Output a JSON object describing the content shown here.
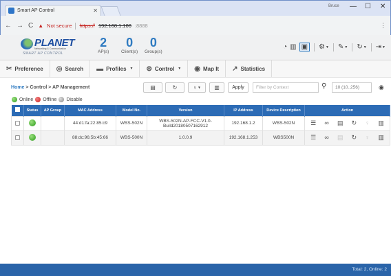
{
  "browser": {
    "tab_title": "Smart AP Control",
    "user_label": "Bruce",
    "not_secure": "Not secure",
    "url_scheme": "https://",
    "url_host": "192.168.1.100",
    "url_port": ":8888",
    "min_glyph": "—",
    "max_glyph": "☐",
    "close_glyph": "✕"
  },
  "header": {
    "logo_brand": "PLANET",
    "logo_tagline": "Networking & Communication",
    "logo_sub": "SMART AP CONTROL",
    "counters": [
      {
        "num": "2",
        "label": "AP(s)"
      },
      {
        "num": "0",
        "label": "Client(s)"
      },
      {
        "num": "0",
        "label": "Group(s)"
      }
    ]
  },
  "menu": {
    "items": [
      {
        "label": "Preference",
        "icon": "wrench-icon"
      },
      {
        "label": "Search",
        "icon": "search-icon"
      },
      {
        "label": "Profiles",
        "icon": "folder-icon",
        "dropdown": true
      },
      {
        "label": "Control",
        "icon": "router-icon",
        "dropdown": true
      },
      {
        "label": "Map It",
        "icon": "map-pin-icon"
      },
      {
        "label": "Statistics",
        "icon": "chart-line-icon"
      }
    ]
  },
  "breadcrumb": {
    "home": "Home",
    "rest": " > Control > AP Management"
  },
  "toolbar": {
    "apply_label": "Apply",
    "filter_placeholder": "Filter by Context",
    "paging_placeholder": "10 (10..256)"
  },
  "legend": {
    "online": "Online",
    "offline": "Offline",
    "disable": "Disable"
  },
  "table": {
    "headers": {
      "status": "Status",
      "group": "AP Group",
      "mac": "MAC Address",
      "model": "Model No.",
      "version": "Version",
      "ip": "IP Address",
      "desc": "Device Description",
      "action": "Action"
    },
    "rows": [
      {
        "status": "online",
        "group": "",
        "mac": "44:d1:fa:22:85:c9",
        "model": "WBS-502N",
        "version": "WBS-502N-AP-FCC-V1.0-Build20180507162912",
        "ip": "192.168.1.2",
        "desc": "WBS-502N"
      },
      {
        "status": "online",
        "group": "",
        "mac": "88:dc:96:5b:45:66",
        "model": "WBS-500N",
        "version": "1.0.0.9",
        "ip": "192.168.1.253",
        "desc": "WBS500N"
      }
    ]
  },
  "footer": {
    "summary": "Total: 2, Online: 2"
  },
  "colors": {
    "accent": "#2c6bb5",
    "footer": "#2a64a9",
    "online": "#2b9a1b",
    "offline": "#cc1e1e"
  }
}
